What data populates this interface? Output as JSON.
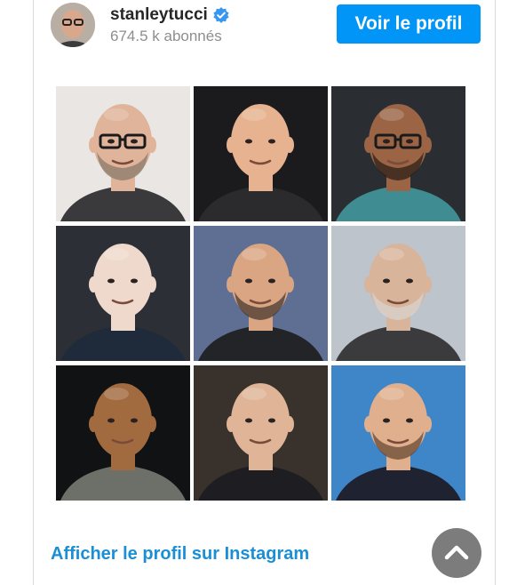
{
  "post": {
    "username": "stanleytucci",
    "followers": "674.5 k abonnés",
    "view_profile_button": "Voir le profil",
    "footer_link": "Afficher le profil sur Instagram"
  },
  "grid": {
    "tiles": [
      {
        "bg": "#e9e6e3",
        "skin": "#e0b49a",
        "shirt": "#3a3a3c",
        "glasses": true,
        "beard": "#8a7a6a"
      },
      {
        "bg": "#1b1b1d",
        "skin": "#e6b28f",
        "shirt": "#2b2b2e",
        "glasses": false,
        "beard": null
      },
      {
        "bg": "#2a2e33",
        "skin": "#9a6445",
        "shirt": "#3f8c93",
        "glasses": true,
        "beard": "#2c1f18"
      },
      {
        "bg": "#2c3036",
        "skin": "#efd9cc",
        "shirt": "#1f2a3a",
        "glasses": false,
        "beard": null
      },
      {
        "bg": "#5e6f93",
        "skin": "#d9a582",
        "shirt": "#232427",
        "glasses": false,
        "beard": "#4a3a30"
      },
      {
        "bg": "#bec4cb",
        "skin": "#d8b49b",
        "shirt": "#3b3b3d",
        "glasses": false,
        "beard": "#d8d4cf"
      },
      {
        "bg": "#111214",
        "skin": "#a26a3f",
        "shirt": "#6c7068",
        "glasses": false,
        "beard": null
      },
      {
        "bg": "#39312c",
        "skin": "#dfb497",
        "shirt": "#1e1e22",
        "glasses": false,
        "beard": null
      },
      {
        "bg": "#3f86c8",
        "skin": "#e0b08e",
        "shirt": "#1f2230",
        "glasses": false,
        "beard": "#6a4a32"
      }
    ]
  },
  "colors": {
    "accent": "#0095f6",
    "link": "#1a8fd6",
    "verified": "#3897f0"
  }
}
